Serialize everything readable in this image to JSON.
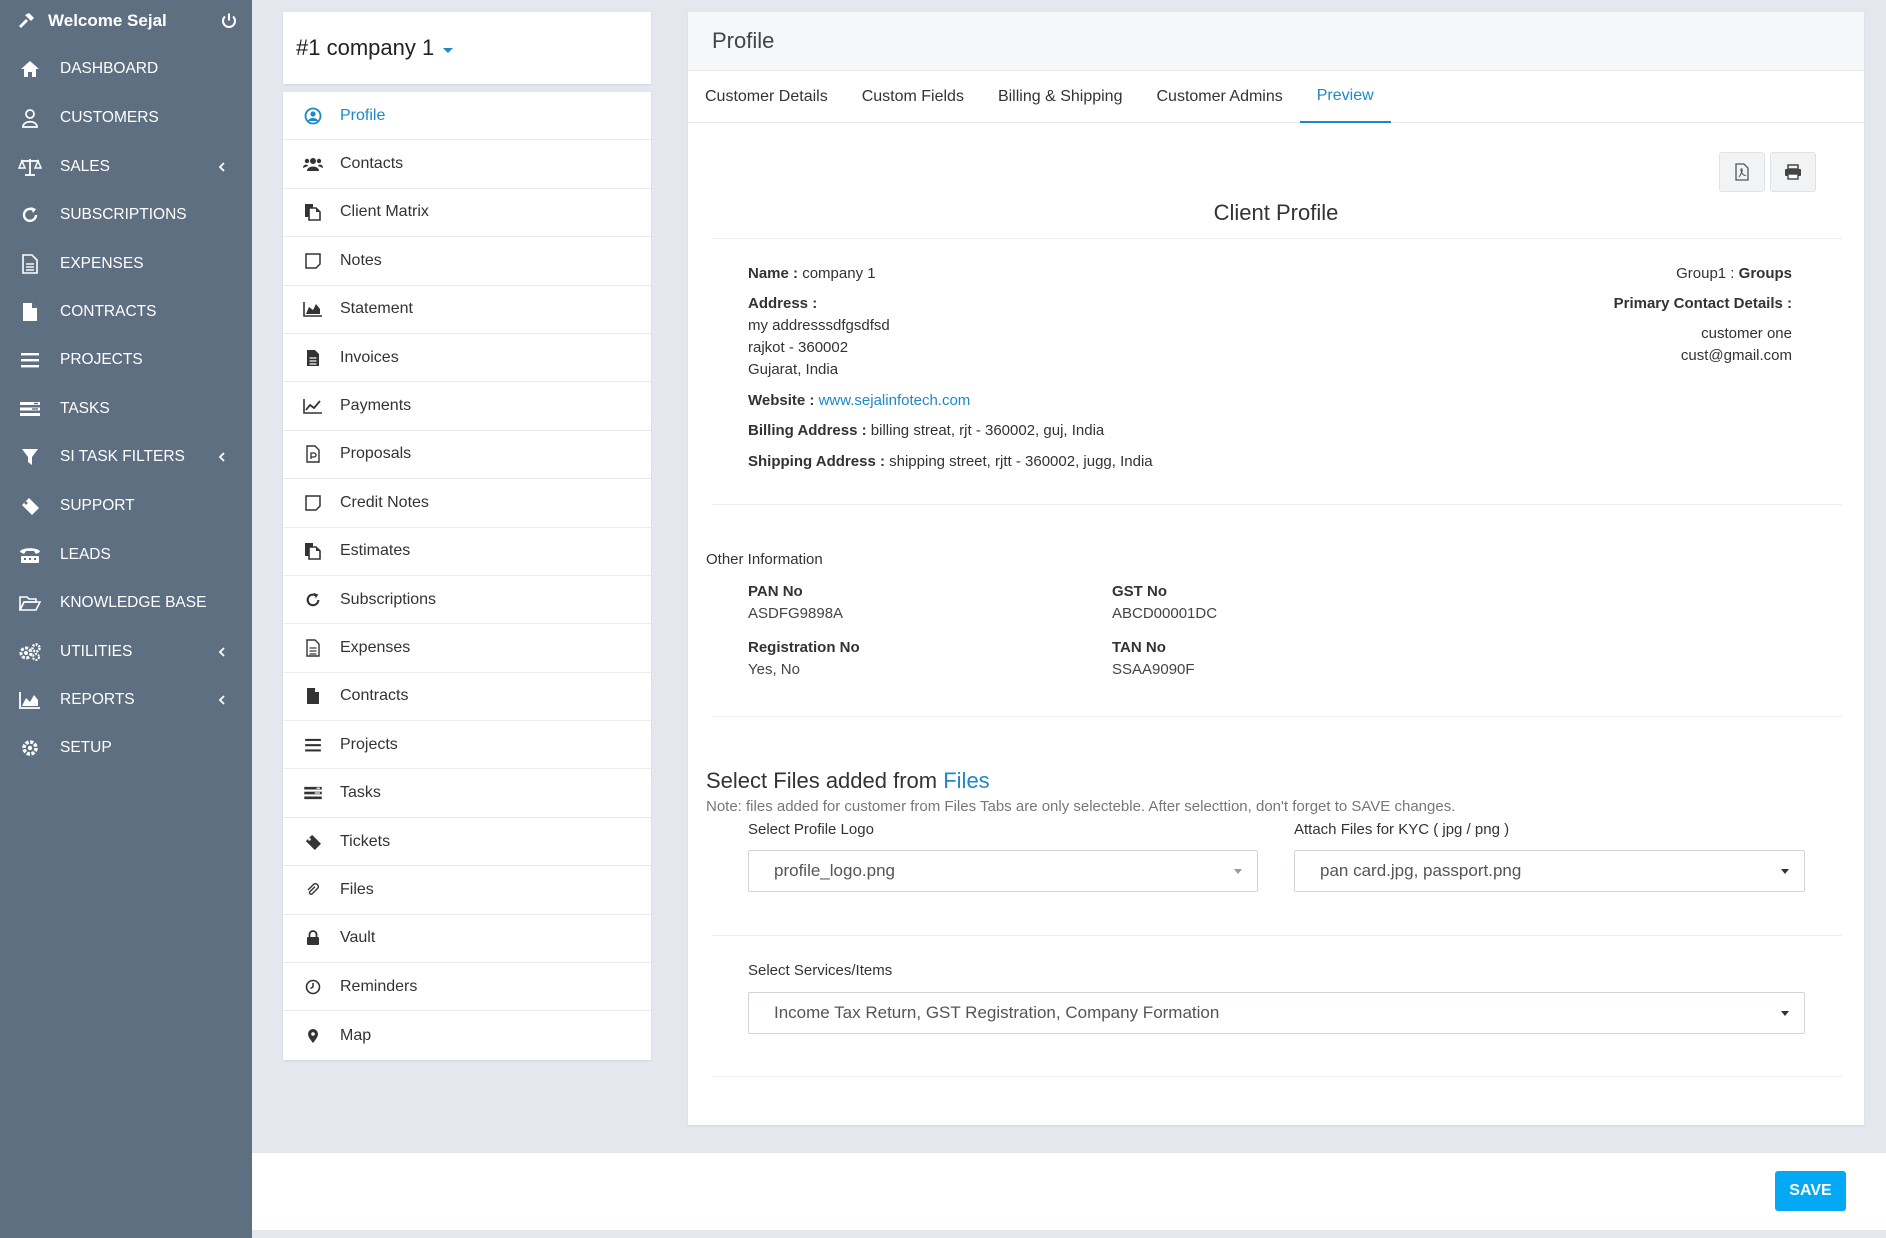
{
  "sidebar": {
    "welcome": "Welcome Sejal",
    "items": [
      {
        "label": "DASHBOARD",
        "icon": "home-icon"
      },
      {
        "label": "CUSTOMERS",
        "icon": "user-icon"
      },
      {
        "label": "SALES",
        "icon": "balance-scale-icon",
        "has_submenu": true
      },
      {
        "label": "SUBSCRIPTIONS",
        "icon": "refresh-icon"
      },
      {
        "label": "EXPENSES",
        "icon": "file-text-icon"
      },
      {
        "label": "CONTRACTS",
        "icon": "file-icon"
      },
      {
        "label": "PROJECTS",
        "icon": "bars-icon"
      },
      {
        "label": "TASKS",
        "icon": "tasks-icon"
      },
      {
        "label": "SI TASK FILTERS",
        "icon": "filter-icon",
        "has_submenu": true
      },
      {
        "label": "SUPPORT",
        "icon": "ticket-icon"
      },
      {
        "label": "LEADS",
        "icon": "tty-icon"
      },
      {
        "label": "KNOWLEDGE BASE",
        "icon": "folder-open-icon"
      },
      {
        "label": "UTILITIES",
        "icon": "cogs-icon",
        "has_submenu": true
      },
      {
        "label": "REPORTS",
        "icon": "area-chart-icon",
        "has_submenu": true
      },
      {
        "label": "SETUP",
        "icon": "cog-icon"
      }
    ]
  },
  "company": {
    "title": "#1 company 1"
  },
  "customer_nav": [
    {
      "label": "Profile",
      "icon": "user-circle-icon",
      "active": true
    },
    {
      "label": "Contacts",
      "icon": "users-icon"
    },
    {
      "label": "Client Matrix",
      "icon": "files-icon"
    },
    {
      "label": "Notes",
      "icon": "sticky-note-icon"
    },
    {
      "label": "Statement",
      "icon": "area-chart-icon"
    },
    {
      "label": "Invoices",
      "icon": "file-text-icon"
    },
    {
      "label": "Payments",
      "icon": "line-chart-icon"
    },
    {
      "label": "Proposals",
      "icon": "file-powerpoint-icon"
    },
    {
      "label": "Credit Notes",
      "icon": "sticky-note-icon"
    },
    {
      "label": "Estimates",
      "icon": "files-icon"
    },
    {
      "label": "Subscriptions",
      "icon": "refresh-icon"
    },
    {
      "label": "Expenses",
      "icon": "file-text-icon"
    },
    {
      "label": "Contracts",
      "icon": "file-icon"
    },
    {
      "label": "Projects",
      "icon": "bars-icon"
    },
    {
      "label": "Tasks",
      "icon": "tasks-icon"
    },
    {
      "label": "Tickets",
      "icon": "ticket-icon"
    },
    {
      "label": "Files",
      "icon": "paperclip-icon"
    },
    {
      "label": "Vault",
      "icon": "lock-icon"
    },
    {
      "label": "Reminders",
      "icon": "clock-icon"
    },
    {
      "label": "Map",
      "icon": "map-marker-icon"
    }
  ],
  "main": {
    "header": "Profile",
    "tabs": [
      {
        "label": "Customer Details"
      },
      {
        "label": "Custom Fields"
      },
      {
        "label": "Billing & Shipping"
      },
      {
        "label": "Customer Admins"
      },
      {
        "label": "Preview",
        "active": true
      }
    ],
    "client_profile_title": "Client Profile",
    "profile": {
      "name_label": "Name :",
      "name_value": "company 1",
      "address_label": "Address :",
      "address_line1": "my addresssdfgsdfsd",
      "address_line2": "rajkot - 360002",
      "address_line3": "Gujarat, India",
      "website_label": "Website :",
      "website_value": "www.sejalinfotech.com",
      "billing_label": "Billing Address :",
      "billing_value": "billing streat, rjt - 360002, guj, India",
      "shipping_label": "Shipping Address :",
      "shipping_value": "shipping street, rjtt - 360002, jugg, India",
      "group_label": "Group1 :",
      "group_value": "Groups",
      "primary_contact_label": "Primary Contact Details :",
      "primary_contact_name": "customer one",
      "primary_contact_email": "cust@gmail.com"
    },
    "other_info": {
      "title": "Other Information",
      "pan_label": "PAN No",
      "pan_value": "ASDFG9898A",
      "gst_label": "GST No",
      "gst_value": "ABCD00001DC",
      "reg_label": "Registration No",
      "reg_value": "Yes, No",
      "tan_label": "TAN No",
      "tan_value": "SSAA9090F"
    },
    "files": {
      "title_prefix": "Select Files added from",
      "title_link": "Files",
      "note": "Note: files added for customer from Files Tabs are only selecteble. After selecttion, don't forget to SAVE changes.",
      "logo_label": "Select Profile Logo",
      "logo_value": "profile_logo.png",
      "kyc_label": "Attach Files for KYC ( jpg / png )",
      "kyc_value": "pan card.jpg, passport.png",
      "services_label": "Select Services/Items",
      "services_value": "Income Tax Return, GST Registration, Company Formation"
    }
  },
  "footer": {
    "save_label": "SAVE"
  },
  "colors": {
    "sidebar_bg": "#5f6f82",
    "accent": "#1e88c8",
    "save_button": "#03a9f4"
  }
}
